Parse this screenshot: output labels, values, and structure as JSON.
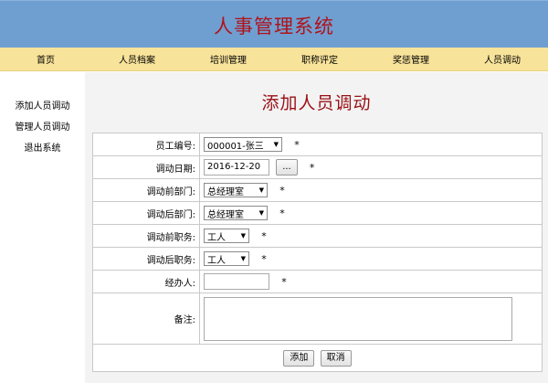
{
  "header": {
    "title": "人事管理系统"
  },
  "nav": {
    "items": [
      {
        "label": "首页"
      },
      {
        "label": "人员档案"
      },
      {
        "label": "培训管理"
      },
      {
        "label": "职称评定"
      },
      {
        "label": "奖惩管理"
      },
      {
        "label": "人员调动"
      }
    ]
  },
  "sidebar": {
    "items": [
      {
        "label": "添加人员调动"
      },
      {
        "label": "管理人员调动"
      },
      {
        "label": "退出系统"
      }
    ]
  },
  "main": {
    "title": "添加人员调动",
    "required_mark": "*",
    "fields": {
      "employee_id": {
        "label": "员工编号:",
        "value": "000001-张三"
      },
      "transfer_date": {
        "label": "调动日期:",
        "value": "2016-12-20",
        "picker_label": "..."
      },
      "dept_before": {
        "label": "调动前部门:",
        "value": "总经理室"
      },
      "dept_after": {
        "label": "调动后部门:",
        "value": "总经理室"
      },
      "post_before": {
        "label": "调动前职务:",
        "value": "工人"
      },
      "post_after": {
        "label": "调动后职务:",
        "value": "工人"
      },
      "handler": {
        "label": "经办人:",
        "value": ""
      },
      "remarks": {
        "label": "备注:",
        "value": ""
      }
    },
    "buttons": {
      "add": "添加",
      "cancel": "取消"
    }
  }
}
